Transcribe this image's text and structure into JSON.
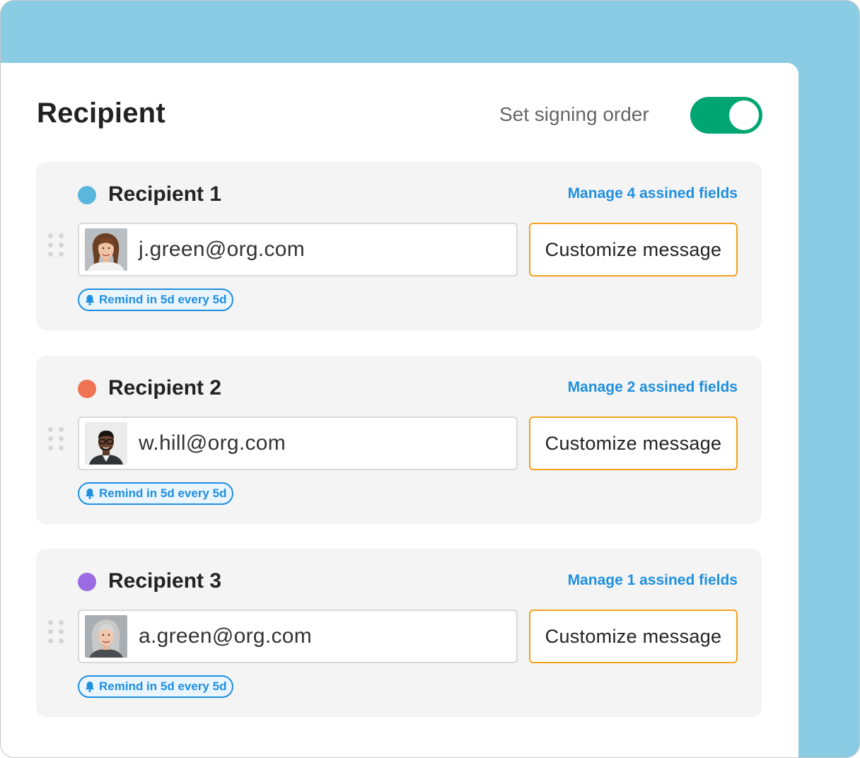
{
  "header": {
    "title": "Recipient",
    "signing_order_label": "Set signing order",
    "signing_order_enabled": true
  },
  "colors": {
    "toggle_on": "#00a672",
    "link": "#1f8fe0",
    "customize_border": "#f4a21e",
    "background": "#89cce3"
  },
  "recipients": [
    {
      "name": "Recipient 1",
      "dot_color": "#5ab6dc",
      "manage_label": "Manage 4 assined fields",
      "email": "j.green@org.com",
      "customize_label": "Customize message",
      "remind_label": "Remind in 5d every 5d",
      "avatar": "woman-brown-hair"
    },
    {
      "name": "Recipient 2",
      "dot_color": "#ef7352",
      "manage_label": "Manage 2 assined fields",
      "email": "w.hill@org.com",
      "customize_label": "Customize message",
      "remind_label": "Remind in 5d every 5d",
      "avatar": "man-glasses"
    },
    {
      "name": "Recipient 3",
      "dot_color": "#9a6be3",
      "manage_label": "Manage 1 assined fields",
      "email": "a.green@org.com",
      "customize_label": "Customize message",
      "remind_label": "Remind in 5d every 5d",
      "avatar": "woman-gray-hair"
    }
  ]
}
